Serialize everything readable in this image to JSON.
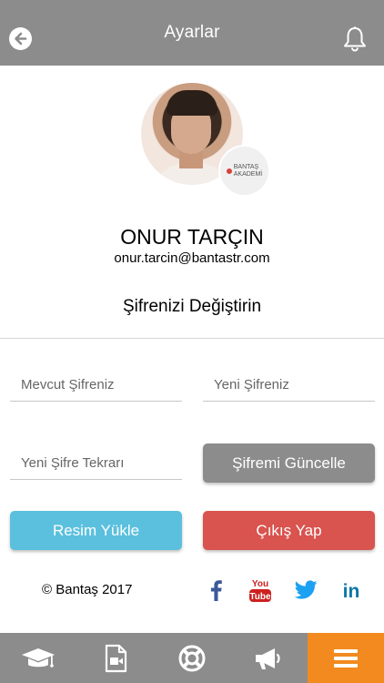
{
  "header": {
    "title": "Ayarlar"
  },
  "profile": {
    "name": "ONUR TARÇIN",
    "email": "onur.tarcin@bantastr.com",
    "badge_line1": "BANTAŞ",
    "badge_line2": "AKADEMİ"
  },
  "password_section": {
    "title": "Şifrenizi Değiştirin",
    "current_placeholder": "Mevcut Şifreniz",
    "new_placeholder": "Yeni Şifreniz",
    "repeat_placeholder": "Yeni Şifre Tekrarı",
    "update_label": "Şifremi Güncelle"
  },
  "actions": {
    "upload_label": "Resim Yükle",
    "logout_label": "Çıkış Yap"
  },
  "footer": {
    "copyright": "© Bantaş 2017",
    "social": [
      "facebook-icon",
      "youtube-icon",
      "twitter-icon",
      "linkedin-icon"
    ]
  },
  "tabbar": {
    "items": [
      "graduation-cap-icon",
      "video-file-icon",
      "lifebuoy-icon",
      "megaphone-icon",
      "menu-icon"
    ],
    "active_index": 4
  },
  "colors": {
    "header": "#8c8c8c",
    "tabbar": "#8c8c8c",
    "active_tab": "#f28a1f",
    "upload": "#5bc0de",
    "logout": "#d9534f",
    "facebook": "#3b5998",
    "youtube": "#cd201f",
    "twitter": "#1da1f2",
    "linkedin": "#0e76a8"
  }
}
